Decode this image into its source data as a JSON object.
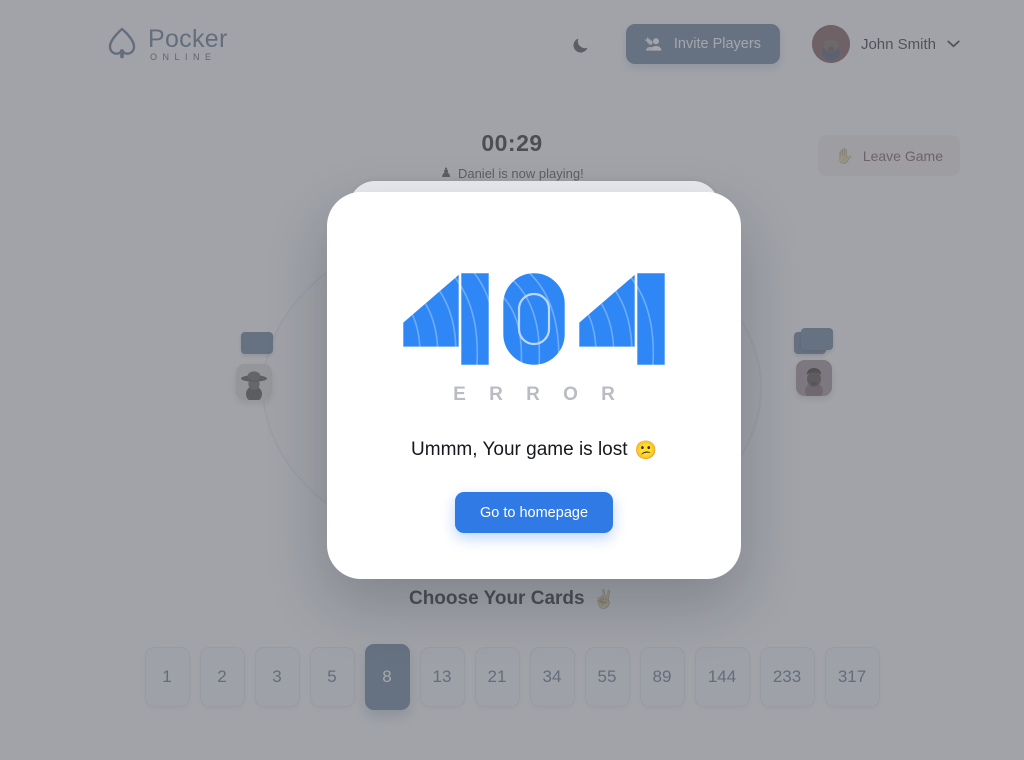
{
  "header": {
    "logo": {
      "title": "Pocker",
      "subtitle": "ONLINE",
      "icon": "spade-icon"
    },
    "theme_toggle_icon": "moon-icon",
    "invite_button": {
      "label": "Invite Players",
      "icon": "person-add-icon",
      "color": "#2f7ae5"
    },
    "user": {
      "name": "John Smith",
      "avatar": "user-avatar",
      "chevron_icon": "chevron-down-icon"
    }
  },
  "game": {
    "timer": "00:29",
    "turn_status": {
      "emoji": "♟",
      "text": "Daniel is now playing!"
    },
    "leave_button": {
      "label": "Leave Game",
      "emoji": "✋",
      "color": "#c0392f"
    },
    "players": [
      {
        "position": "left",
        "cards": 1,
        "avatar": "player-avatar-hat"
      },
      {
        "position": "right",
        "cards": 2,
        "avatar": "player-avatar-pink"
      }
    ]
  },
  "choose_cards": {
    "title": "Choose Your Cards",
    "emoji": "✌️",
    "selected": "8",
    "cards": [
      "1",
      "2",
      "3",
      "5",
      "8",
      "13",
      "21",
      "34",
      "55",
      "89",
      "144",
      "233",
      "317"
    ]
  },
  "modal": {
    "code": "404",
    "error_word": "E R R O R",
    "message": "Ummm, Your game is lost",
    "message_emoji": "😕",
    "button_label": "Go to homepage",
    "accent_color": "#2f7ae5"
  }
}
